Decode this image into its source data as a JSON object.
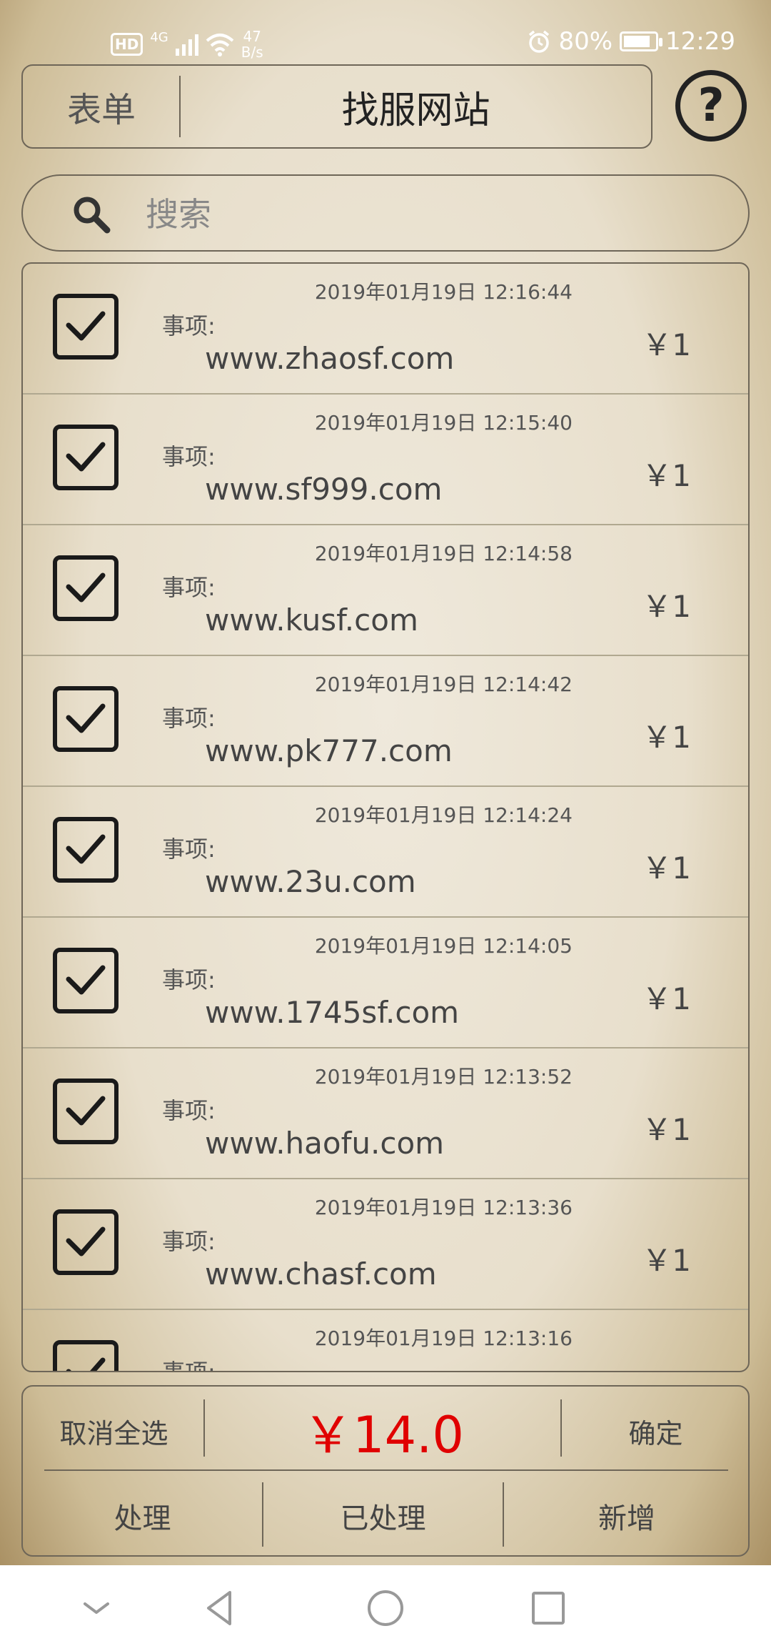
{
  "status_bar": {
    "hd": "HD",
    "network": "4G",
    "speed_value": "47",
    "speed_unit": "B/s",
    "battery": "80%",
    "time": "12:29"
  },
  "header": {
    "tab_label": "表单",
    "title": "找服网站",
    "help_symbol": "?"
  },
  "search": {
    "placeholder": "搜索"
  },
  "items": [
    {
      "time": "2019年01月19日 12:16:44",
      "label": "事项:",
      "url": "www.zhaosf.com",
      "price": "￥1",
      "checked": true
    },
    {
      "time": "2019年01月19日 12:15:40",
      "label": "事项:",
      "url": "www.sf999.com",
      "price": "￥1",
      "checked": true
    },
    {
      "time": "2019年01月19日 12:14:58",
      "label": "事项:",
      "url": "www.kusf.com",
      "price": "￥1",
      "checked": true
    },
    {
      "time": "2019年01月19日 12:14:42",
      "label": "事项:",
      "url": "www.pk777.com",
      "price": "￥1",
      "checked": true
    },
    {
      "time": "2019年01月19日 12:14:24",
      "label": "事项:",
      "url": "www.23u.com",
      "price": "￥1",
      "checked": true
    },
    {
      "time": "2019年01月19日 12:14:05",
      "label": "事项:",
      "url": "www.1745sf.com",
      "price": "￥1",
      "checked": true
    },
    {
      "time": "2019年01月19日 12:13:52",
      "label": "事项:",
      "url": "www.haofu.com",
      "price": "￥1",
      "checked": true
    },
    {
      "time": "2019年01月19日 12:13:36",
      "label": "事项:",
      "url": "www.chasf.com",
      "price": "￥1",
      "checked": true
    },
    {
      "time": "2019年01月19日 12:13:16",
      "label": "事项:",
      "url": "",
      "price": "",
      "checked": true
    }
  ],
  "footer": {
    "cancel_all": "取消全选",
    "total": "￥14.0",
    "confirm": "确定",
    "tabs": [
      "处理",
      "已处理",
      "新增"
    ]
  },
  "colors": {
    "total_red": "#e00000",
    "border": "#6e6658"
  }
}
